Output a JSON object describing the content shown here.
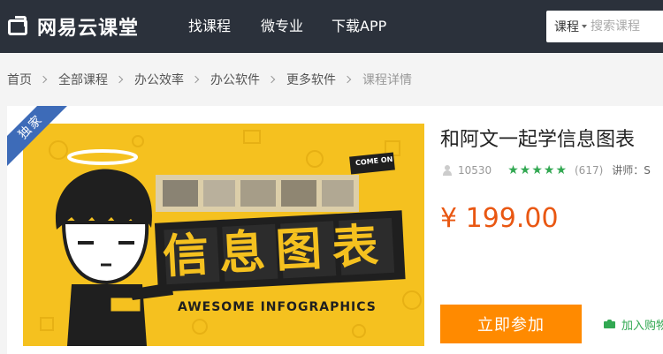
{
  "header": {
    "logo_text": "网易云课堂",
    "nav": [
      {
        "label": "找课程"
      },
      {
        "label": "微专业"
      },
      {
        "label": "下载APP"
      }
    ],
    "search": {
      "category": "课程",
      "placeholder": "搜索课程"
    }
  },
  "breadcrumb": [
    {
      "label": "首页"
    },
    {
      "label": "全部课程"
    },
    {
      "label": "办公效率"
    },
    {
      "label": "办公软件"
    },
    {
      "label": "更多软件"
    },
    {
      "label": "课程详情"
    }
  ],
  "course": {
    "badge": "独家",
    "cover": {
      "tag": "COME ON",
      "headline": "信息图表",
      "subtitle": "AWESOME INFOGRAPHICS"
    },
    "title": "和阿文一起学信息图表",
    "learners": "10530",
    "rating": 5,
    "rating_count": "(617)",
    "teacher_prefix": "讲师：S",
    "price": "¥ 199.00",
    "buy_label": "立即参加",
    "cart_label": "加入购物"
  },
  "colors": {
    "nav_bg": "#2b313b",
    "accent_orange": "#ff8a00",
    "price_red": "#e95712",
    "star_green": "#32a852",
    "badge_blue": "#3d6bb8",
    "cover_yellow": "#f5c11f"
  },
  "icons": [
    "logo-icon",
    "chevron-right-icon",
    "caret-down-icon",
    "user-icon",
    "star-icon",
    "cart-icon"
  ]
}
